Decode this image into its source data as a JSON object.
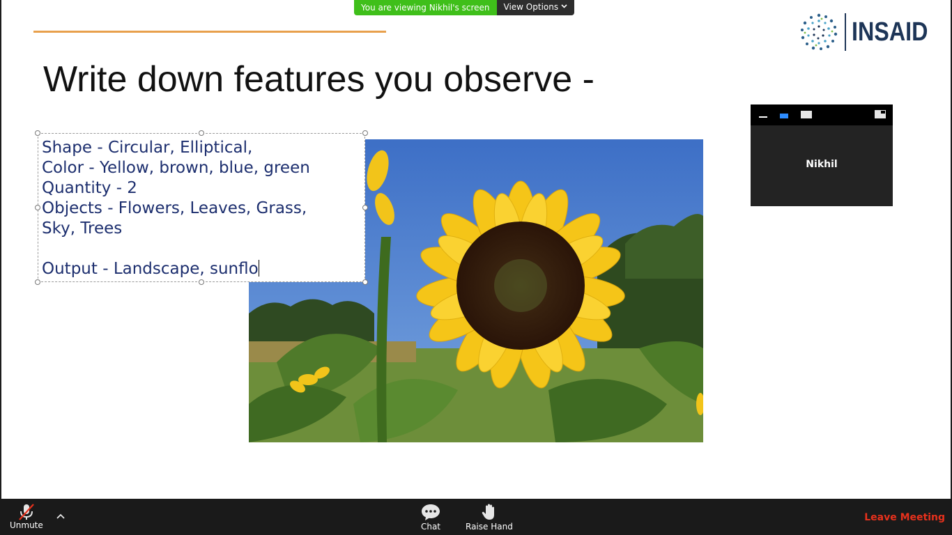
{
  "banner": {
    "notice": "You are viewing Nikhil's screen",
    "view_options": "View Options"
  },
  "slide": {
    "title": "Write down features you observe -",
    "logo_text": "INSAID",
    "text_box_lines": [
      "Shape - Circular, Elliptical,",
      "Color - Yellow, brown, blue, green",
      "Quantity - 2",
      "Objects - Flowers, Leaves, Grass,",
      "Sky, Trees",
      "",
      "Output - Landscape, sunflo"
    ],
    "accent_color": "#e8a04c"
  },
  "video": {
    "participant_name": "Nikhil"
  },
  "toolbar": {
    "unmute_label": "Unmute",
    "chat_label": "Chat",
    "raise_hand_label": "Raise Hand",
    "leave_label": "Leave Meeting"
  },
  "colors": {
    "banner_green": "#3fbf1a",
    "leave_red": "#e8311c",
    "text_blue": "#1c2e6e"
  },
  "icons": {
    "mic": "mic-muted-icon",
    "caret": "chevron-up-icon",
    "chat": "chat-bubble-icon",
    "hand": "raise-hand-icon"
  }
}
